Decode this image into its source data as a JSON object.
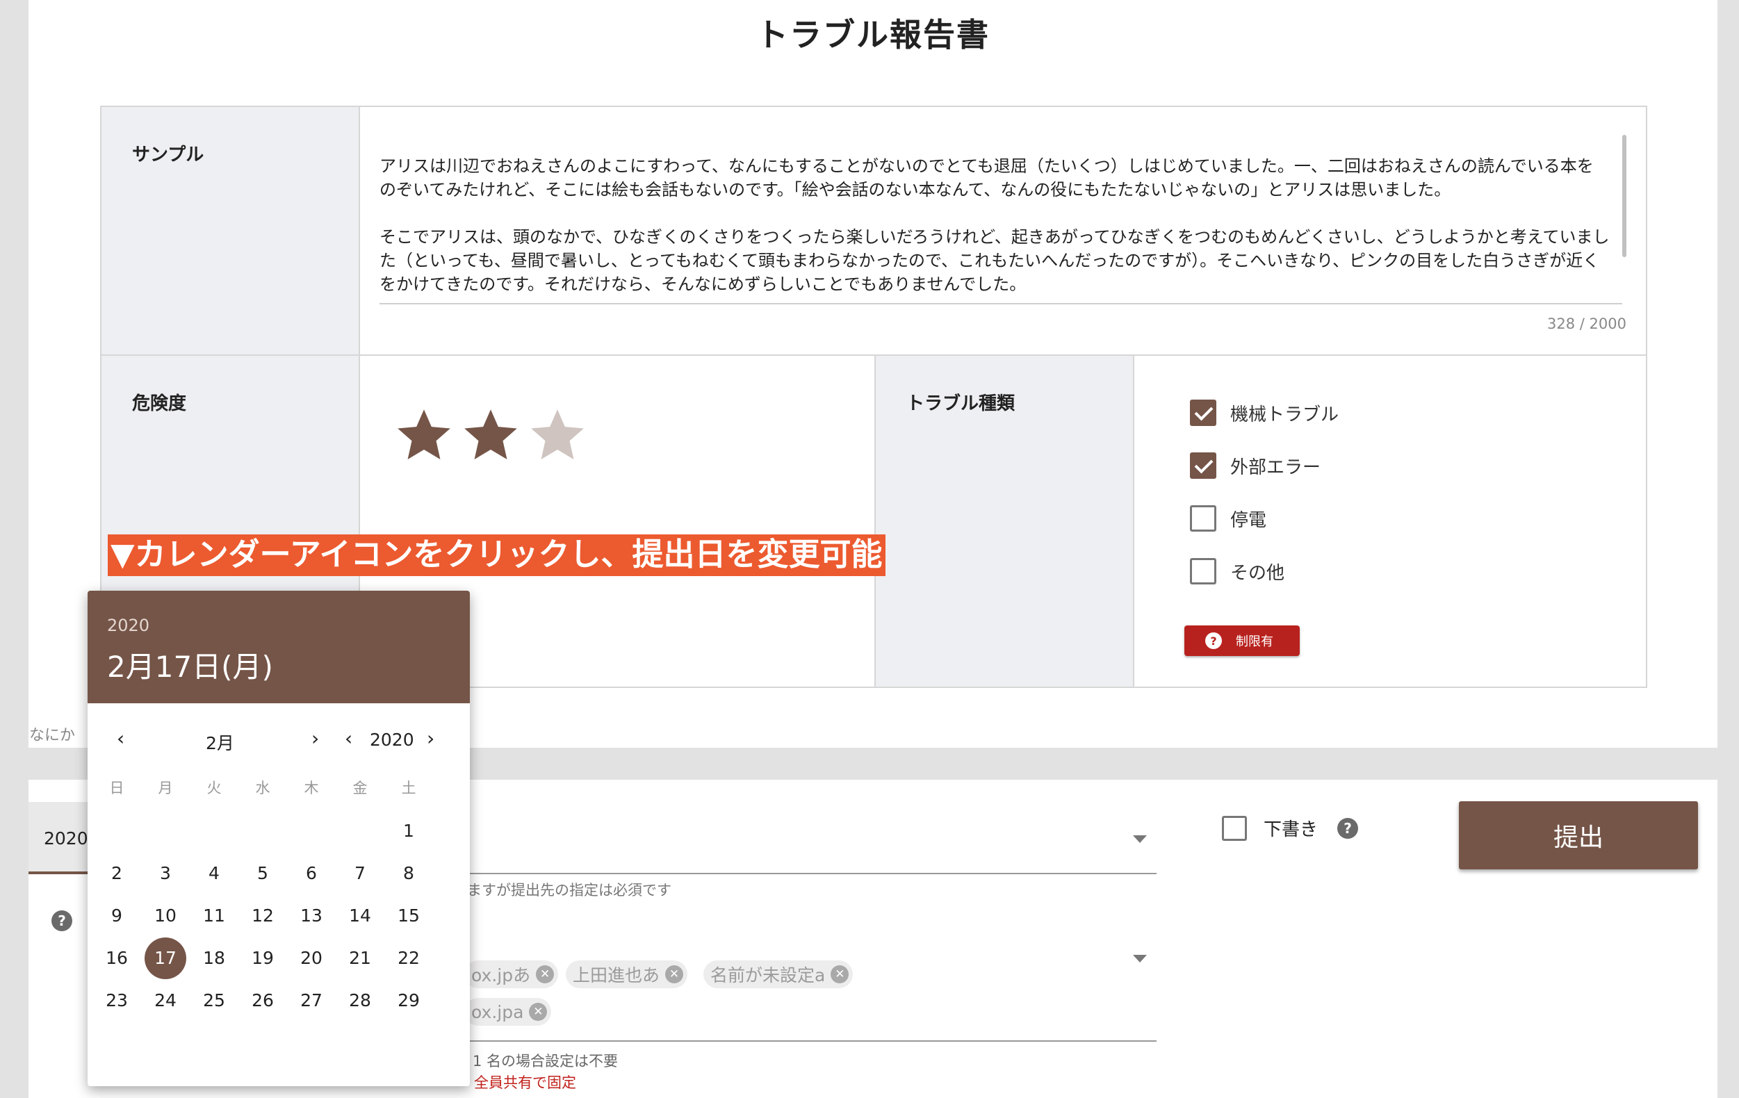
{
  "title": "トラブル報告書",
  "sample": {
    "label": "サンプル",
    "paragraph1": "アリスは川辺でおねえさんのよこにすわって、なんにもすることがないのでとても退屈（たいくつ）しはじめていました。一、二回はおねえさんの読んでいる本をのぞいてみたけれど、そこには絵も会話もないのです。「絵や会話のない本なんて、なんの役にもたたないじゃないの」とアリスは思いました。",
    "paragraph2": "そこでアリスは、頭のなかで、ひなぎくのくさりをつくったら楽しいだろうけれど、起きあがってひなぎくをつむのもめんどくさいし、どうしようかと考えていました（といっても、昼間で暑いし、とってもねむくて頭もまわらなかったので、これもたいへんだったのですが）。そこへいきなり、ピンクの目をした白うさぎが近くをかけてきたのです。それだけなら、そんなにめずらしいことでもありませんでした。",
    "counter": "328 / 2000"
  },
  "danger": {
    "label": "危険度",
    "rating": 2,
    "max": 3
  },
  "trouble_type": {
    "label": "トラブル種類",
    "options": [
      {
        "label": "機械トラブル",
        "checked": true
      },
      {
        "label": "外部エラー",
        "checked": true
      },
      {
        "label": "停電",
        "checked": false
      },
      {
        "label": "その他",
        "checked": false
      }
    ],
    "limit_badge": "制限有"
  },
  "banner": "▼カレンダーアイコンをクリックし、提出日を変更可能",
  "side_text": "なにか",
  "bottom": {
    "tab_text": "2020",
    "helper1": "ますが提出先の指定は必須です",
    "chips_row1": [
      "ox.jpあ",
      "上田進也あ",
      "名前が未設定a"
    ],
    "chips_row2": [
      "ox.jpa"
    ],
    "helper2": "1 名の場合設定は不要",
    "helper3": "全員共有で固定",
    "draft_label": "下書き",
    "submit_label": "提出"
  },
  "date_picker": {
    "year": "2020",
    "date_label": "2月17日(月)",
    "month_nav": "2月",
    "year_nav": "2020",
    "weekdays": [
      "日",
      "月",
      "火",
      "水",
      "木",
      "金",
      "土"
    ],
    "days": [
      "1",
      "2",
      "3",
      "4",
      "5",
      "6",
      "7",
      "8",
      "9",
      "10",
      "11",
      "12",
      "13",
      "14",
      "15",
      "16",
      "17",
      "18",
      "19",
      "20",
      "21",
      "22",
      "23",
      "24",
      "25",
      "26",
      "27",
      "28",
      "29"
    ],
    "first_weekday_index": 6,
    "selected_day": "17"
  },
  "colors": {
    "accent": "#755548",
    "banner": "#ec5a2f",
    "badge": "#b8221e",
    "star_on": "#755548",
    "star_off": "#cfc4bf"
  }
}
